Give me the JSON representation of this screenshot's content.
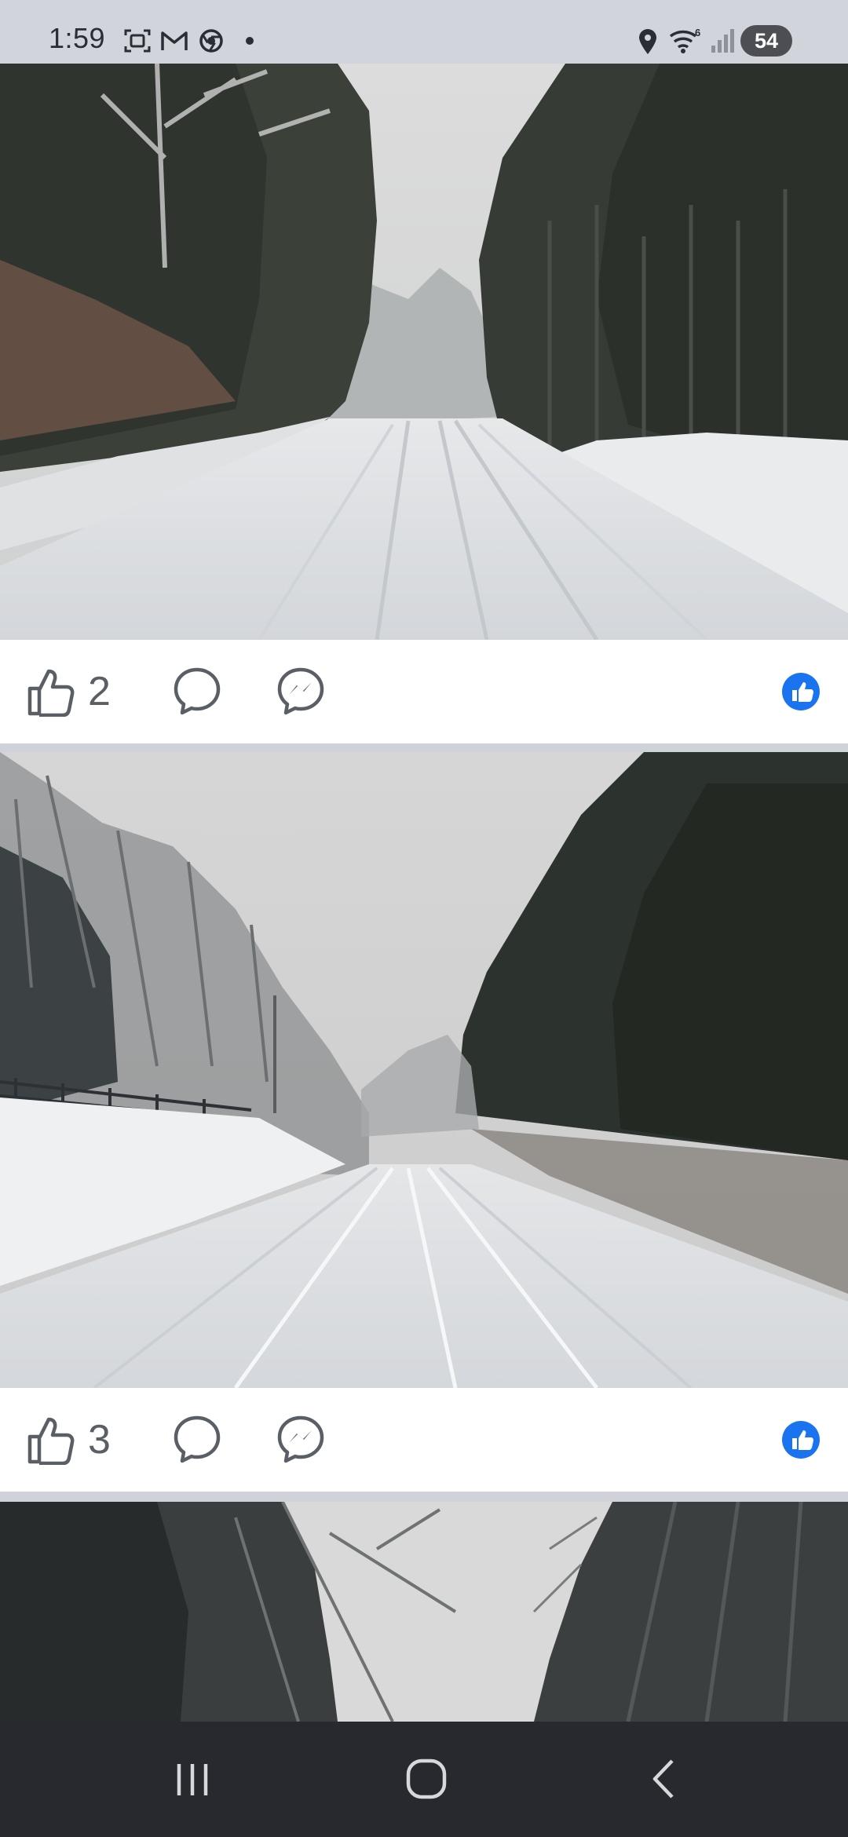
{
  "status_bar": {
    "time": "1:59",
    "battery": "54",
    "icons": [
      "screenshot-icon",
      "gmail-icon",
      "chrome-icon",
      "notification-dot-icon",
      "location-icon",
      "wifi-6-icon",
      "signal-icon",
      "battery-icon"
    ]
  },
  "posts": [
    {
      "photo": "snowy-road-with-trees-1",
      "like_count": "2"
    },
    {
      "photo": "snowy-road-with-fence",
      "like_count": "3"
    },
    {
      "photo": "snowy-trees-partial"
    }
  ],
  "actions": [
    "like-icon",
    "comment-icon",
    "messenger-icon",
    "like-reaction-badge"
  ],
  "nav": [
    "recent-apps-button",
    "home-button",
    "back-button"
  ],
  "colors": {
    "reaction_blue": "#1a74f0",
    "nav_bg": "#27292e",
    "status_bg": "#d1d4da"
  }
}
